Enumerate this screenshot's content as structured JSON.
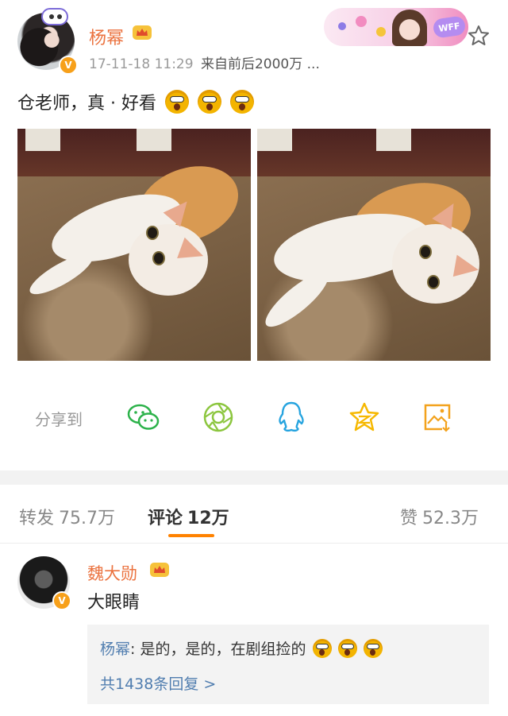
{
  "post": {
    "author": "杨幂",
    "timestamp": "17-11-18 11:29",
    "source_prefix": "来自",
    "source_name": "前后2000万 ...",
    "text": "仓老师，真 · 好看",
    "emoji_icon": "scared-face-emoji",
    "photos": [
      "cat-photo-1",
      "cat-photo-2"
    ]
  },
  "banner": {
    "tag": "WFF"
  },
  "share": {
    "label": "分享到",
    "targets": [
      "wechat-icon",
      "moments-icon",
      "qq-icon",
      "qzone-icon",
      "save-image-icon"
    ]
  },
  "tabs": {
    "repost_label": "转发",
    "repost_count": "75.7万",
    "comment_label": "评论",
    "comment_count": "12万",
    "like_label": "赞",
    "like_count": "52.3万"
  },
  "comment": {
    "author": "魏大勋",
    "text": "大眼睛",
    "reply": {
      "author": "杨幂",
      "separator": ":",
      "text": " 是的，是的，在剧组捡的",
      "more": "共1438条回复 >"
    }
  },
  "colors": {
    "username": "#eb7340",
    "link": "#507daf",
    "accent": "#ff8200",
    "verified": "#f7a01a"
  }
}
